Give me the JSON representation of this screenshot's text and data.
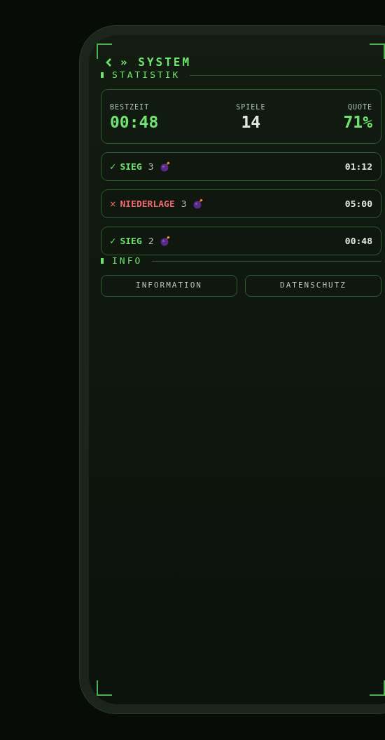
{
  "header": {
    "title": "» SYSTEM"
  },
  "stats_section": {
    "title": "STATISTIK"
  },
  "stats": [
    {
      "label": "BESTZEIT",
      "value": "00:48",
      "accent": true
    },
    {
      "label": "SPIELE",
      "value": "14",
      "accent": false
    },
    {
      "label": "QUOTE",
      "value": "71%",
      "accent": true
    }
  ],
  "games": [
    {
      "kind": "win",
      "mark": "✓",
      "result": "SIEG",
      "bombs": "3",
      "time": "01:12"
    },
    {
      "kind": "loss",
      "mark": "✕",
      "result": "NIEDERLAGE",
      "bombs": "3",
      "time": "05:00"
    },
    {
      "kind": "win",
      "mark": "✓",
      "result": "SIEG",
      "bombs": "2",
      "time": "00:48"
    }
  ],
  "info_section": {
    "title": "INFO"
  },
  "buttons": [
    "INFORMATION",
    "DATENSCHUTZ"
  ]
}
